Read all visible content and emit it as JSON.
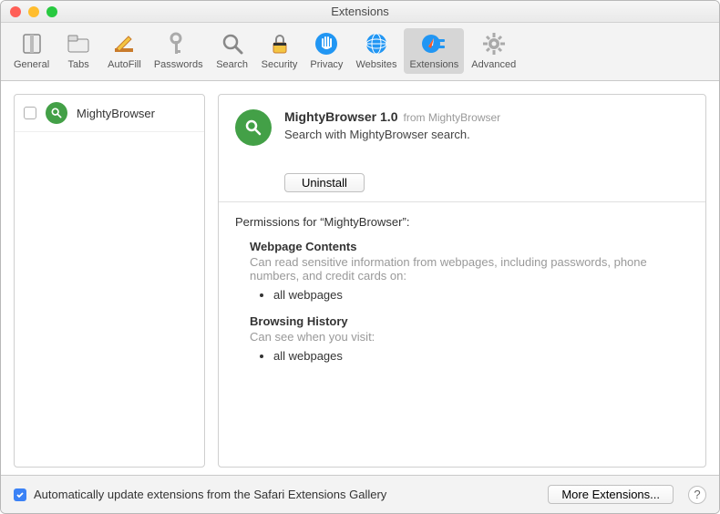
{
  "window": {
    "title": "Extensions"
  },
  "toolbar": {
    "items": [
      {
        "label": "General"
      },
      {
        "label": "Tabs"
      },
      {
        "label": "AutoFill"
      },
      {
        "label": "Passwords"
      },
      {
        "label": "Search"
      },
      {
        "label": "Security"
      },
      {
        "label": "Privacy"
      },
      {
        "label": "Websites"
      },
      {
        "label": "Extensions"
      },
      {
        "label": "Advanced"
      }
    ]
  },
  "sidebar": {
    "items": [
      {
        "name": "MightyBrowser"
      }
    ]
  },
  "details": {
    "title": "MightyBrowser 1.0",
    "from_label": "from MightyBrowser",
    "description": "Search with MightyBrowser search.",
    "uninstall_label": "Uninstall"
  },
  "permissions": {
    "heading": "Permissions for “MightyBrowser”:",
    "sections": [
      {
        "title": "Webpage Contents",
        "desc": "Can read sensitive information from webpages, including passwords, phone numbers, and credit cards on:",
        "items": [
          "all webpages"
        ]
      },
      {
        "title": "Browsing History",
        "desc": "Can see when you visit:",
        "items": [
          "all webpages"
        ]
      }
    ]
  },
  "footer": {
    "auto_update_label": "Automatically update extensions from the Safari Extensions Gallery",
    "more_label": "More Extensions...",
    "help_label": "?"
  }
}
